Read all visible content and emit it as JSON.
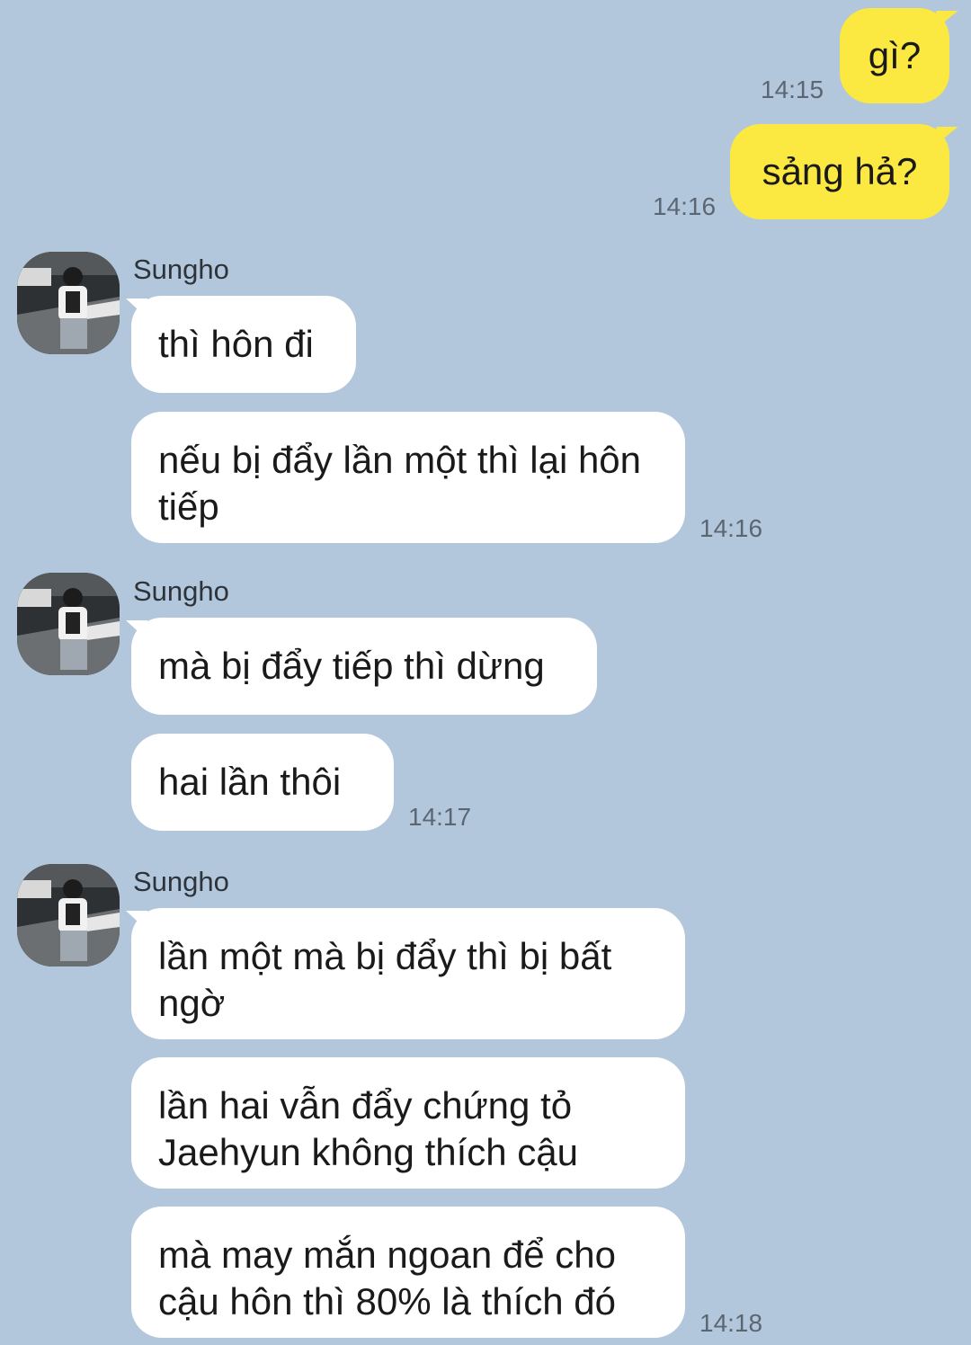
{
  "outgoing": [
    {
      "text": "gì?",
      "time": "14:15"
    },
    {
      "text": "sảng hả?",
      "time": "14:16"
    }
  ],
  "groups": [
    {
      "sender": "Sungho",
      "avatar_icon": "profile-photo-icon",
      "messages": [
        {
          "text": "thì hôn đi"
        },
        {
          "text": "nếu bị đẩy lần một thì lại hôn tiếp"
        }
      ],
      "time": "14:16"
    },
    {
      "sender": "Sungho",
      "avatar_icon": "profile-photo-icon",
      "messages": [
        {
          "text": "mà bị đẩy tiếp thì dừng"
        },
        {
          "text": "hai lần thôi"
        }
      ],
      "time": "14:17"
    },
    {
      "sender": "Sungho",
      "avatar_icon": "profile-photo-icon",
      "messages": [
        {
          "text": "lần một mà bị đẩy thì bị bất ngờ"
        },
        {
          "text": "lần hai vẫn đẩy chứng tỏ Jaehyun không thích cậu"
        },
        {
          "text": "mà may mắn ngoan để cho cậu hôn thì 80% là thích đó"
        }
      ],
      "time": "14:18"
    }
  ],
  "colors": {
    "background": "#b3c7dc",
    "outgoing_bubble": "#fbe840",
    "incoming_bubble": "#ffffff",
    "timestamp": "#5b6673"
  }
}
